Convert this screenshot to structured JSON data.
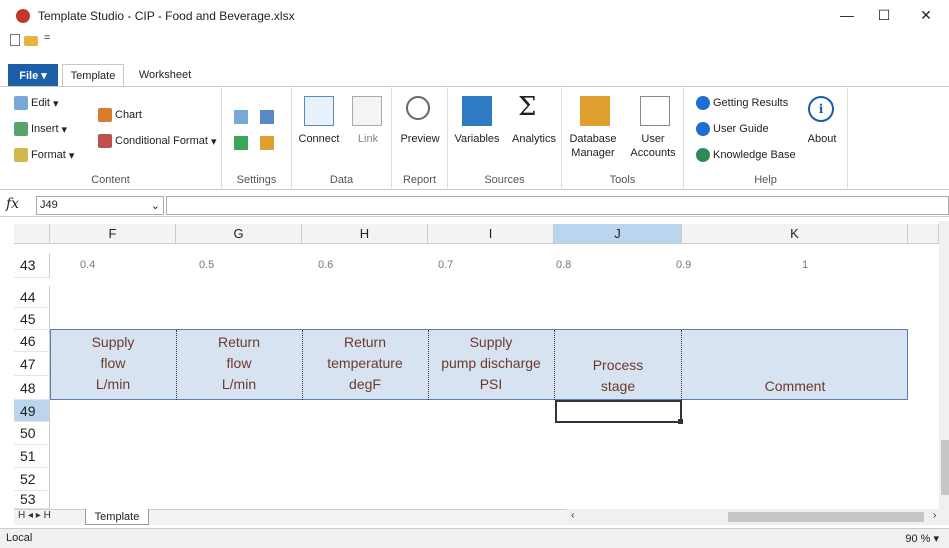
{
  "window": {
    "title": "Template Studio - CIP - Food and Beverage.xlsx",
    "minimize": "—",
    "maximize": "☐",
    "close": "✕"
  },
  "qat": {
    "dropdown": "="
  },
  "tabs": {
    "file": "File ▾",
    "items": [
      "Template",
      "Worksheet"
    ],
    "active": "Template"
  },
  "ribbon": {
    "content": {
      "label": "Content",
      "edit": "Edit",
      "insert": "Insert",
      "format": "Format",
      "chart": "Chart",
      "conditional_format": "Conditional Format"
    },
    "settings": {
      "label": "Settings"
    },
    "data": {
      "label": "Data",
      "connect": "Connect",
      "link": "Link"
    },
    "report": {
      "label": "Report",
      "preview": "Preview"
    },
    "sources": {
      "label": "Sources",
      "variables": "Variables",
      "analytics": "Analytics"
    },
    "tools": {
      "label": "Tools",
      "database_manager": [
        "Database",
        "Manager"
      ],
      "user_accounts": [
        "User",
        "Accounts"
      ]
    },
    "help": {
      "label": "Help",
      "getting_results": "Getting Results",
      "user_guide": "User Guide",
      "knowledge_base": "Knowledge Base",
      "about": "About"
    }
  },
  "formula_bar": {
    "fx": "fx",
    "name_box": "J49",
    "formula": ""
  },
  "columns": [
    "F",
    "G",
    "H",
    "I",
    "J",
    "K"
  ],
  "selected_column": "J",
  "rows": [
    "43",
    "44",
    "45",
    "46",
    "47",
    "48",
    "49",
    "50",
    "51",
    "52",
    "53"
  ],
  "selected_row": "49",
  "row43_values": [
    "0.4",
    "0.5",
    "0.6",
    "0.7",
    "0.8",
    "0.9",
    "1"
  ],
  "header_cells": {
    "F": [
      "Supply",
      "flow",
      "L/min"
    ],
    "G": [
      "Return",
      "flow",
      "L/min"
    ],
    "H": [
      "Return",
      "temperature",
      "degF"
    ],
    "I": [
      "Supply",
      "pump discharge",
      "PSI"
    ],
    "J": [
      "Process",
      "stage"
    ],
    "K": [
      "Comment"
    ]
  },
  "sheet_tabs": {
    "nav": "H ◂ ▸ H",
    "active": "Template"
  },
  "status": {
    "left": "Local",
    "zoom": "90 % ▾"
  },
  "colors": {
    "accent": "#1c5fa8",
    "header_fill": "#d7e3f1",
    "header_text": "#6b3a2b",
    "selection": "#bcd5ee"
  }
}
